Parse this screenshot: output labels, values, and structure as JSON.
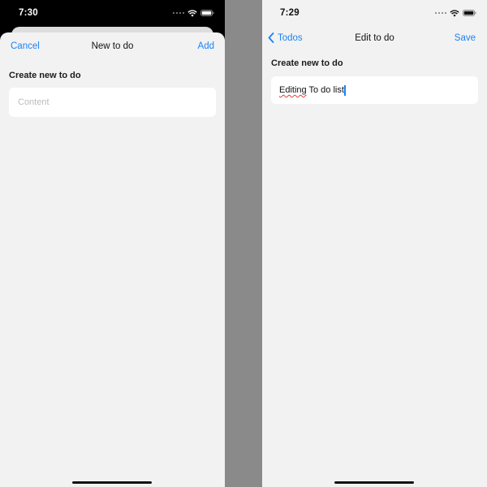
{
  "colors": {
    "accent": "#1a82f6",
    "background": "#f2f2f2",
    "divider": "#8a8a8a"
  },
  "left_screen": {
    "status_bar": {
      "time": "7:30"
    },
    "nav": {
      "cancel_label": "Cancel",
      "title": "New to do",
      "add_label": "Add"
    },
    "section_label": "Create new to do",
    "content_field": {
      "value": "",
      "placeholder": "Content"
    }
  },
  "right_screen": {
    "status_bar": {
      "time": "7:29"
    },
    "nav": {
      "back_label": "Todos",
      "title": "Edit to do",
      "save_label": "Save"
    },
    "section_label": "Create new to do",
    "content_field": {
      "value_misspelled": "Editing",
      "value_rest": " To do list"
    }
  }
}
